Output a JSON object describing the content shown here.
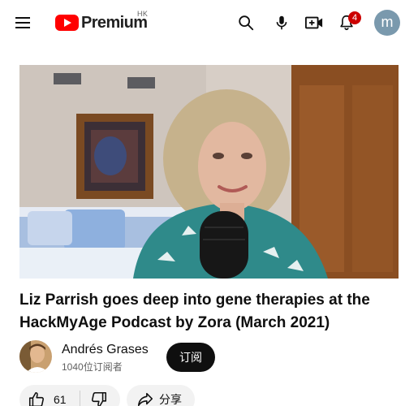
{
  "header": {
    "logo_text": "Premium",
    "region": "HK",
    "notification_count": "4",
    "avatar_letter": "m"
  },
  "video": {
    "title": "Liz Parrish goes deep into gene therapies at the HackMyAge Podcast by Zora (March 2021)",
    "channel_name": "Andrés Grases",
    "subscribers": "1040位订阅者",
    "subscribe_label": "订阅",
    "like_count": "61",
    "share_label": "分享"
  },
  "colors": {
    "brand_red": "#ff0000",
    "badge_red": "#cc0000",
    "avatar_bg": "#7a99ad",
    "pill_bg": "#f2f2f2"
  },
  "icons": [
    "menu-icon",
    "youtube-logo-icon",
    "search-icon",
    "mic-icon",
    "create-video-icon",
    "bell-icon",
    "like-icon",
    "dislike-icon",
    "share-icon"
  ]
}
